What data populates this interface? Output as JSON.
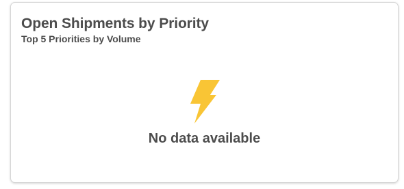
{
  "card": {
    "title": "Open Shipments by Priority",
    "subtitle": "Top 5 Priorities by Volume"
  },
  "empty_state": {
    "icon": "lightning-bolt-icon",
    "icon_color": "#f9c535",
    "message": "No data available"
  },
  "colors": {
    "text": "#4c4c4c",
    "card_border": "#d6d6d6",
    "background": "#ffffff"
  }
}
